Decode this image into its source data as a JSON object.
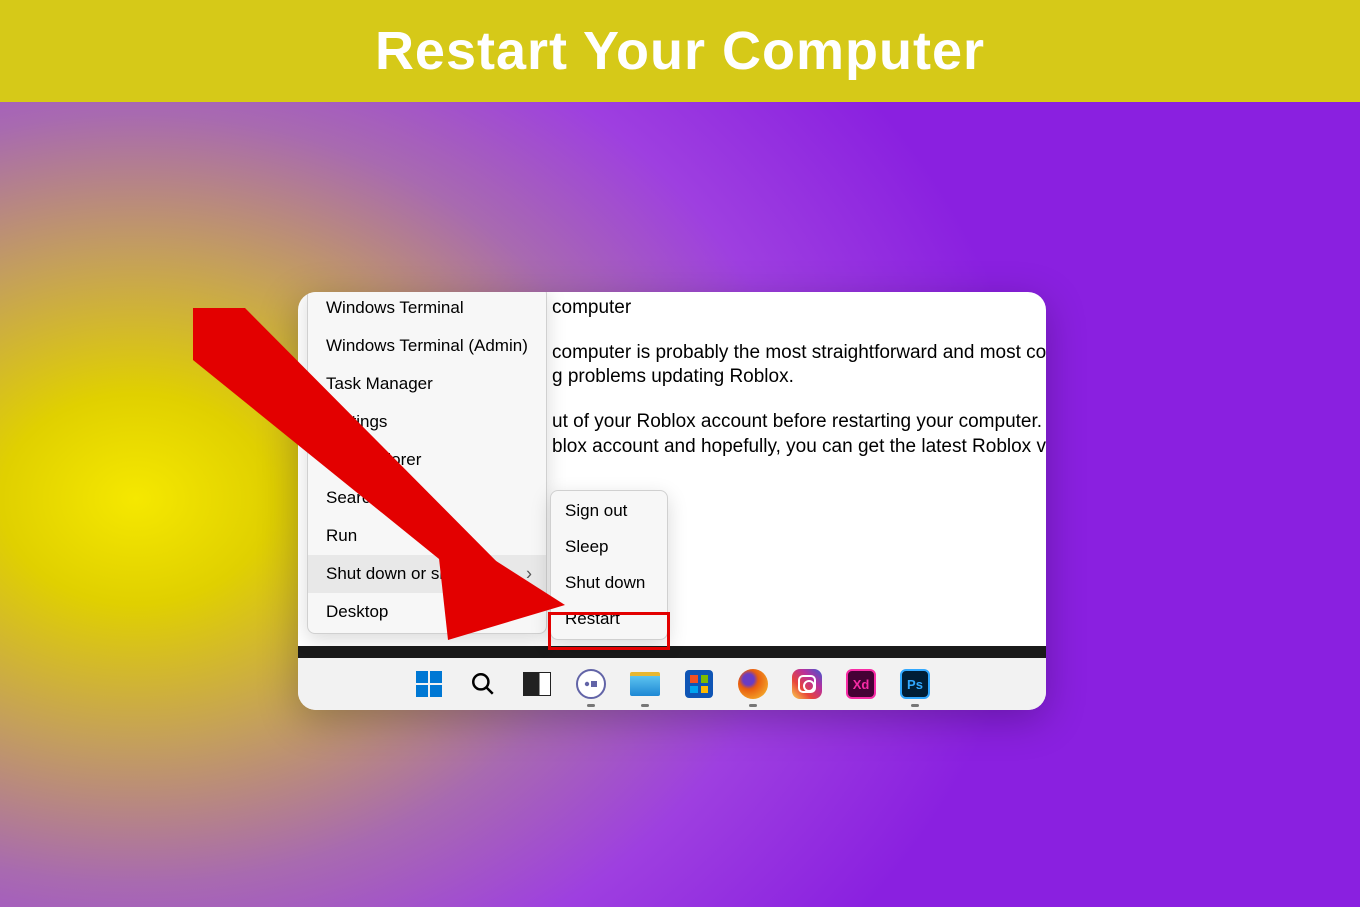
{
  "banner": {
    "title": "Restart Your Computer"
  },
  "article": {
    "frag1": "computer",
    "frag2": "computer is probably the most straightforward and most comm",
    "frag3": "g problems updating Roblox.",
    "frag4": "ut of your Roblox account before restarting your computer. Onc",
    "frag5": "blox account and hopefully, you can get the latest Roblox versio"
  },
  "menu": {
    "items": [
      {
        "label": "Windows Terminal"
      },
      {
        "label": "Windows Terminal (Admin)"
      },
      {
        "label": "Task Manager"
      },
      {
        "label": "Settings"
      },
      {
        "label": "File Explorer"
      },
      {
        "label": "Search"
      },
      {
        "label": "Run"
      },
      {
        "label": "Shut down or sign out"
      },
      {
        "label": "Desktop"
      }
    ]
  },
  "submenu": {
    "items": [
      {
        "label": "Sign out"
      },
      {
        "label": "Sleep"
      },
      {
        "label": "Shut down"
      },
      {
        "label": "Restart"
      }
    ]
  },
  "taskbar": {
    "icons": [
      "start",
      "search",
      "task-view",
      "chat",
      "file-explorer",
      "microsoft-store",
      "firefox",
      "instagram",
      "adobe-xd",
      "photoshop"
    ]
  },
  "colors": {
    "highlight": "#e30000",
    "banner_bg": "#d6c918"
  }
}
